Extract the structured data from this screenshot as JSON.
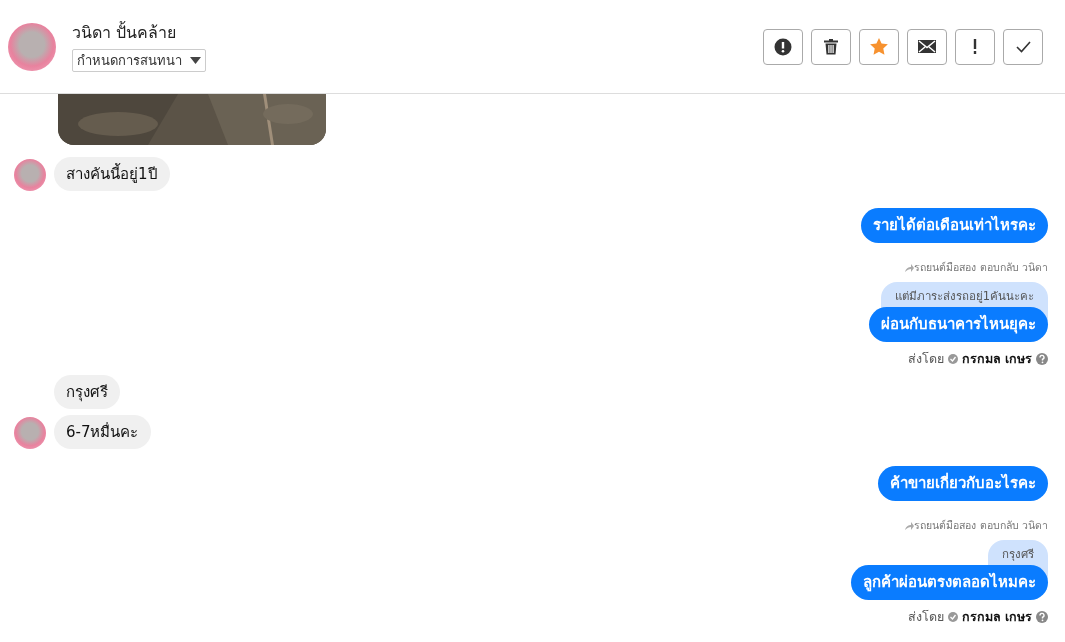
{
  "contact": {
    "name": "วนิดา ปั้นคล้าย",
    "assign_label": "กำหนดการสนทนา"
  },
  "toolbar": [
    {
      "kind": "alert",
      "on": false
    },
    {
      "kind": "trash",
      "on": false
    },
    {
      "kind": "star",
      "on": true
    },
    {
      "kind": "mail",
      "on": false
    },
    {
      "kind": "exclaim",
      "on": false
    },
    {
      "kind": "check",
      "on": false
    }
  ],
  "messages": [
    {
      "kind": "picture"
    },
    {
      "kind": "incoming",
      "text": "สางคันนี้อยู่1ปี",
      "avatar": true
    },
    {
      "kind": "outgoing",
      "text": "รายได้ต่อเดือนเท่าไหรคะ"
    },
    {
      "kind": "outgoing",
      "reply_label": "รถยนต์มือสอง ตอบกลับ วนิดา",
      "quote": "แต่มีภาระส่งรถอยู่1คันนะคะ",
      "text": "ผ่อนกับธนาคารไหนยุคะ",
      "sent_by": {
        "label": "ส่งโดย",
        "name": "กรกมล เกษร"
      }
    },
    {
      "kind": "incoming",
      "text": "กรุงศรี",
      "avatar": false
    },
    {
      "kind": "incoming",
      "text": "6-7หมื่นคะ",
      "avatar": true
    },
    {
      "kind": "outgoing",
      "text": "ค้าขายเกี่ยวกับอะไรคะ"
    },
    {
      "kind": "outgoing",
      "reply_label": "รถยนต์มือสอง ตอบกลับ วนิดา",
      "quote": "กรุงศรี",
      "text": "ลูกค้าผ่อนตรงตลอดไหมคะ",
      "sent_by": {
        "label": "ส่งโดย",
        "name": "กรกมล เกษร"
      }
    }
  ]
}
